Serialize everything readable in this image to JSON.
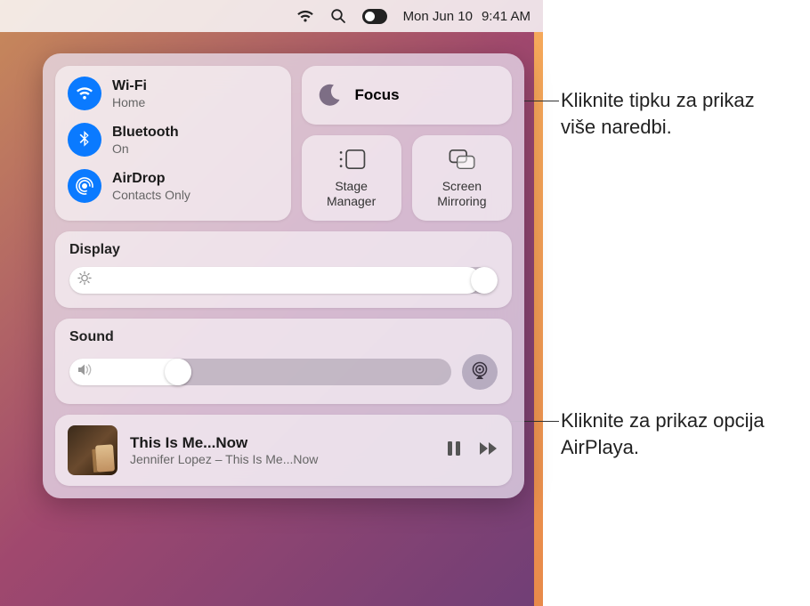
{
  "menubar": {
    "date": "Mon Jun 10",
    "time": "9:41 AM"
  },
  "control_center": {
    "wifi": {
      "label": "Wi-Fi",
      "status": "Home"
    },
    "bluetooth": {
      "label": "Bluetooth",
      "status": "On"
    },
    "airdrop": {
      "label": "AirDrop",
      "status": "Contacts Only"
    },
    "focus": {
      "label": "Focus"
    },
    "stage_manager": {
      "label_line1": "Stage",
      "label_line2": "Manager"
    },
    "screen_mirroring": {
      "label_line1": "Screen",
      "label_line2": "Mirroring"
    },
    "display": {
      "label": "Display",
      "value_pct": 96
    },
    "sound": {
      "label": "Sound",
      "value_pct": 32
    },
    "now_playing": {
      "title": "This Is Me...Now",
      "subtitle": "Jennifer Lopez – This Is Me...Now"
    }
  },
  "callouts": {
    "focus": "Kliknite tipku za prikaz više naredbi.",
    "airplay": "Kliknite za prikaz opcija AirPlaya."
  }
}
